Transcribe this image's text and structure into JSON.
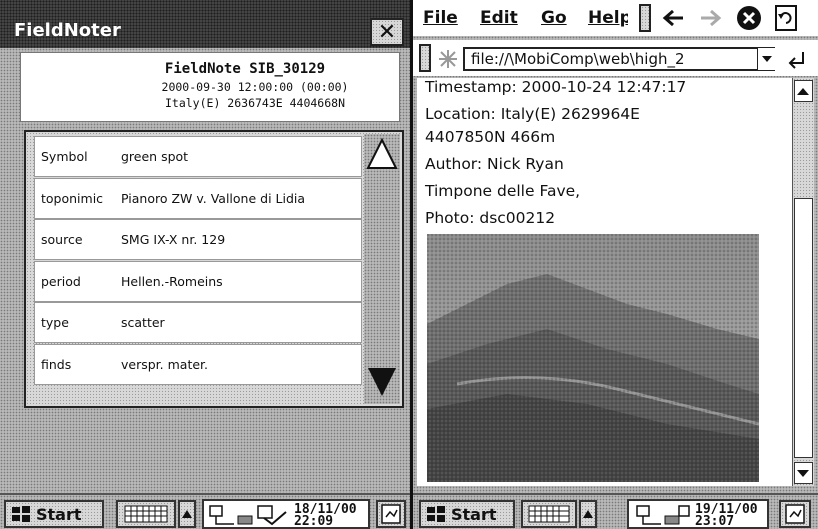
{
  "left": {
    "title": "FieldNoter",
    "close_glyph": "✕",
    "fieldnote": {
      "id": "FieldNote SIB_30129",
      "datetime": "2000-09-30 12:00:00 (00:00)",
      "location": "Italy(E) 2636743E 4404668N"
    },
    "rows": [
      {
        "key": "Symbol",
        "value": "green spot"
      },
      {
        "key": "toponimic",
        "value": "Pianoro ZW v. Vallone di Lidia"
      },
      {
        "key": "source",
        "value": "SMG IX-X nr. 129"
      },
      {
        "key": "period",
        "value": "Hellen.-Romeins"
      },
      {
        "key": "type",
        "value": "scatter"
      },
      {
        "key": "finds",
        "value": "verspr. mater."
      }
    ],
    "taskbar": {
      "start_label": "Start",
      "date": "18/11/00",
      "time": "22:09"
    }
  },
  "right": {
    "menus": [
      "File",
      "Edit",
      "Go",
      "Help"
    ],
    "address": "file://\\MobiComp\\web\\high_2",
    "content": {
      "timestamp": "Timestamp: 2000-10-24 12:47:17",
      "location_line1": "Location: Italy(E) 2629964E",
      "location_line2": "4407850N 466m",
      "author": "Author: Nick Ryan",
      "place": "Timpone delle Fave,",
      "photo": "Photo: dsc00212"
    },
    "taskbar": {
      "start_label": "Start",
      "date": "19/11/00",
      "time": "23:07"
    }
  },
  "icons": {
    "back": "arrow-left-icon",
    "forward": "arrow-right-icon",
    "stop": "stop-icon",
    "refresh": "refresh-icon",
    "favorites": "star-icon",
    "go": "go-icon",
    "keyboard": "keyboard-icon",
    "windows": "windows-logo-icon",
    "network": "network-icon",
    "popup": "popup-icon"
  }
}
